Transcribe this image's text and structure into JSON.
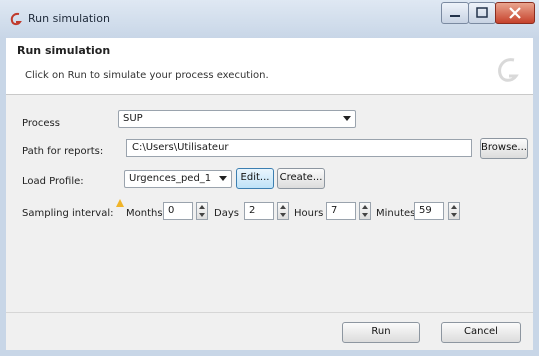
{
  "window": {
    "title": "Run simulation",
    "icon": "app-logo-icon",
    "controls": [
      "minimize-icon",
      "maximize-icon",
      "close-icon"
    ]
  },
  "header": {
    "title": "Run simulation",
    "subtitle": "Click on Run to simulate your process execution."
  },
  "form": {
    "process": {
      "label": "Process",
      "value": "SUP"
    },
    "path": {
      "label": "Path for reports:",
      "value": "C:\\Users\\Utilisateur",
      "browse": "Browse..."
    },
    "load_profile": {
      "label": "Load Profile:",
      "value": "Urgences_ped_1",
      "edit": "Edit...",
      "create": "Create..."
    },
    "sampling": {
      "label": "Sampling interval:",
      "months_label": "Months",
      "months": "0",
      "days_label": "Days",
      "days": "2",
      "hours_label": "Hours",
      "hours": "7",
      "minutes_label": "Minutes",
      "minutes": "59"
    }
  },
  "footer": {
    "run": "Run",
    "cancel": "Cancel"
  },
  "colors": {
    "titlebar": "#c8d6e7",
    "close": "#c6422c",
    "focus": "#3c7fb1"
  }
}
